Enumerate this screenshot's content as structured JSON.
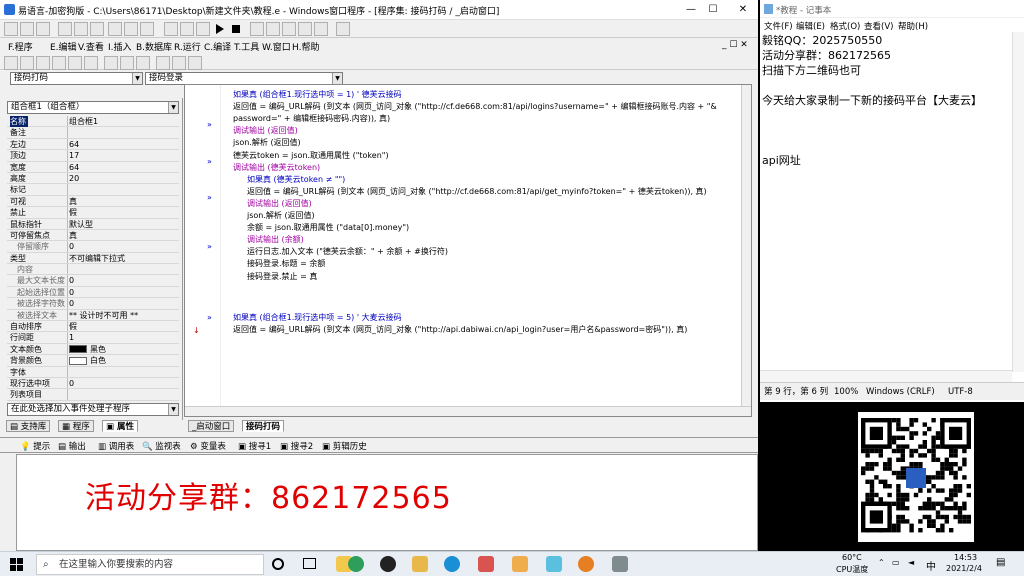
{
  "ide": {
    "title": "易语言-加密狗版 - C:\\Users\\86171\\Desktop\\新建文件夹\\教程.e - Windows窗口程序 - [程序集: 接码打码 / _启动窗口]",
    "menu": [
      "F.程序",
      "E.编辑",
      "V.查看",
      "I.插入",
      "B.数据库",
      "R.运行",
      "C.编译",
      "T.工具",
      "W.窗口",
      "H.帮助"
    ],
    "combo_left": "接码打码",
    "combo_right": "接码登录",
    "component_combo": "组合框1（组合框）",
    "properties": [
      {
        "k": "名称",
        "v": "组合框1",
        "sel": true
      },
      {
        "k": "备注",
        "v": ""
      },
      {
        "k": "左边",
        "v": "64"
      },
      {
        "k": "顶边",
        "v": "17"
      },
      {
        "k": "宽度",
        "v": "64"
      },
      {
        "k": "高度",
        "v": "20"
      },
      {
        "k": "标记",
        "v": ""
      },
      {
        "k": "可视",
        "v": "真"
      },
      {
        "k": "禁止",
        "v": "假"
      },
      {
        "k": "鼠标指针",
        "v": "默认型"
      },
      {
        "k": "可停留焦点",
        "v": "真"
      },
      {
        "k": "停留顺序",
        "v": "0",
        "sub": true
      },
      {
        "k": "类型",
        "v": "不可编辑下拉式"
      },
      {
        "k": "内容",
        "v": "",
        "sub": true
      },
      {
        "k": "最大文本长度",
        "v": "0",
        "sub": true
      },
      {
        "k": "起始选择位置",
        "v": "0",
        "sub": true
      },
      {
        "k": "被选择字符数",
        "v": "0",
        "sub": true
      },
      {
        "k": "被选择文本",
        "v": "** 设计时不可用 **",
        "sub": true
      },
      {
        "k": "自动排序",
        "v": "假"
      },
      {
        "k": "行间距",
        "v": "1"
      },
      {
        "k": "文本颜色",
        "v": "黑色"
      },
      {
        "k": "背景颜色",
        "v": "白色"
      },
      {
        "k": "字体",
        "v": ""
      },
      {
        "k": "现行选中项",
        "v": "0"
      },
      {
        "k": "列表项目",
        "v": ""
      }
    ],
    "event_combo": "在此处选择加入事件处理子程序",
    "panel_tabs": [
      "支持库",
      "程序",
      "属性"
    ],
    "code_lines": [
      "如果真 (组合框1.现行选中项 = 1)  ' 德芙云接码",
      "返回值 = 编码_URL解码 (到文本 (网页_访问_对象 (\"http://cf.de668.com:81/api/logins?username=\" + 编辑框接码账号.内容 + \"&",
      "password=\" + 编辑框接码密码.内容)), 真)",
      "调试输出 (返回值)",
      "json.解析 (返回值)",
      "德芙云token = json.取通用属性 (\"token\")",
      "调试输出 (德芙云token)",
      "如果真 (德芙云token ≠ \"\")",
      "返回值 = 编码_URL解码 (到文本 (网页_访问_对象 (\"http://cf.de668.com:81/api/get_myinfo?token=\" + 德芙云token)), 真)",
      "调试输出 (返回值)",
      "json.解析 (返回值)",
      "余额 = json.取通用属性 (\"data[0].money\")",
      "调试输出 (余额)",
      "运行日志.加入文本 (\"德芙云余额：\" + 余额 + #换行符)",
      "接码登录.标题 = 余额",
      "接码登录.禁止 = 真",
      "",
      "",
      "",
      "如果真 (组合框1.现行选中项 = 5)  ' 大麦云接码",
      "返回值 = 编码_URL解码 (到文本 (网页_访问_对象 (\"http://api.dabiwai.cn/api_login?user=用户名&password=密码\")), 真)"
    ],
    "editor_tabs": [
      "_启动窗口",
      "接码打码"
    ],
    "output_tabs": [
      "提示",
      "输出",
      "调用表",
      "监视表",
      "变量表",
      "搜寻1",
      "搜寻2",
      "剪辑历史"
    ],
    "promo": "活动分享群：862172565"
  },
  "notepad": {
    "title": "*教程 - 记事本",
    "menu": [
      "文件(F)",
      "编辑(E)",
      "格式(O)",
      "查看(V)",
      "帮助(H)"
    ],
    "lines": [
      "毅铭QQ：2025750550",
      "活动分享群：862172565",
      "扫描下方二维码也可",
      "",
      "今天给大家录制一下新的接码平台【大麦云】",
      "",
      "",
      "",
      "api网址"
    ],
    "status": {
      "pos": "第 9 行，第 6 列",
      "zoom": "100%",
      "eol": "Windows (CRLF)",
      "enc": "UTF-8"
    }
  },
  "taskbar": {
    "search_placeholder": "在这里输入你要搜索的内容",
    "temp": "60°C",
    "cpu": "CPU温度",
    "ime": "中",
    "time": "14:53",
    "date": "2021/2/4"
  },
  "colors": {
    "title_bg": "#ffffff",
    "selection": "#0a246a",
    "keyword": "#0000c0",
    "comment": "#008000",
    "promo": "#e00000"
  }
}
